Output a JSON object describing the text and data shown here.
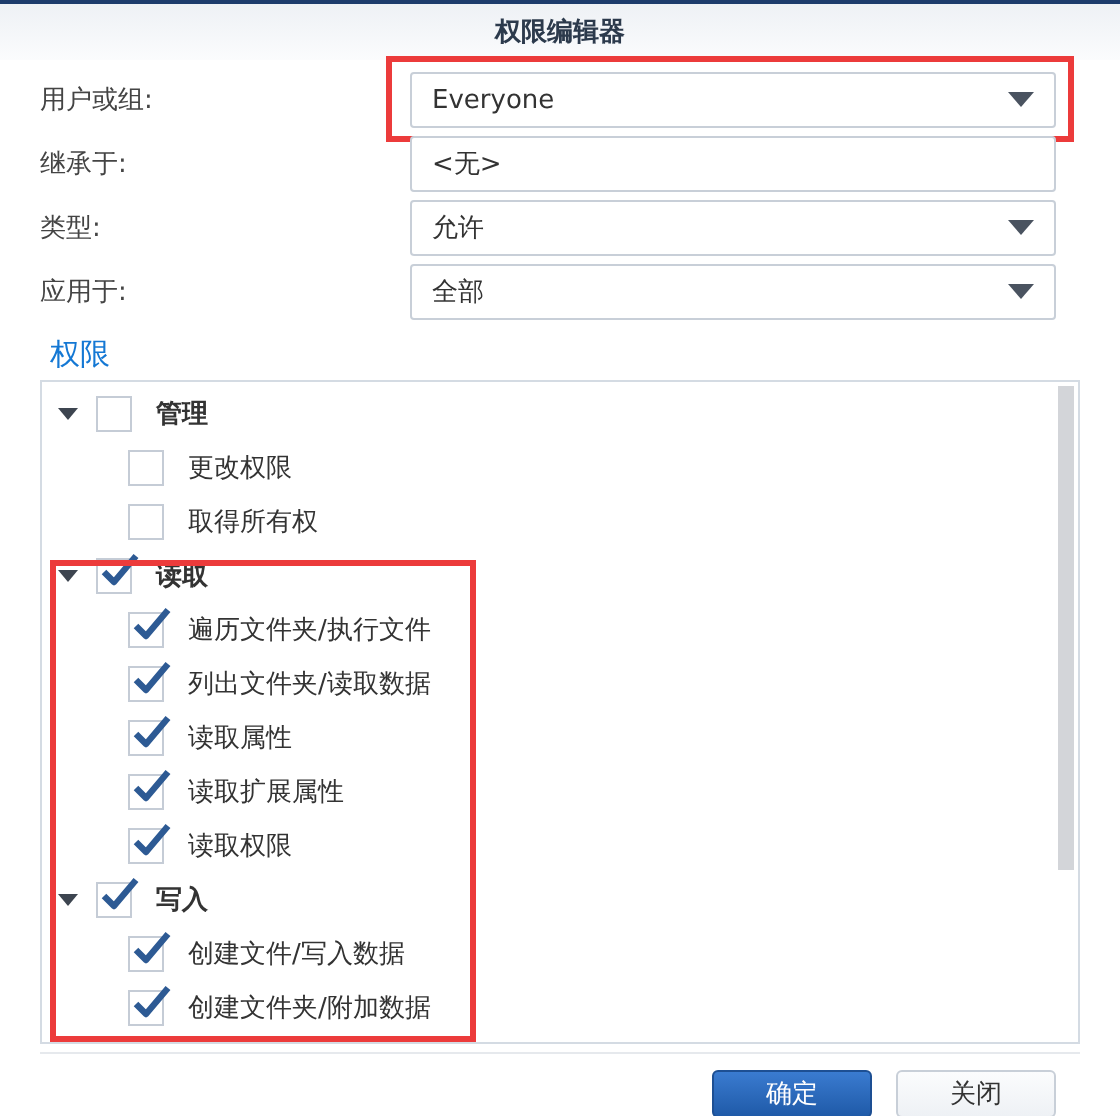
{
  "window": {
    "title": "权限编辑器"
  },
  "fields": [
    {
      "label": "用户或组:",
      "kind": "dropdown",
      "value": "Everyone",
      "highlighted": true
    },
    {
      "label": "继承于:",
      "kind": "text",
      "value": "<无>",
      "highlighted": false
    },
    {
      "label": "类型:",
      "kind": "dropdown",
      "value": "允许",
      "highlighted": false
    },
    {
      "label": "应用于:",
      "kind": "dropdown",
      "value": "全部",
      "highlighted": false
    }
  ],
  "permissions": {
    "title": "权限",
    "groups": [
      {
        "label": "管理",
        "checked": false,
        "expanded": true,
        "highlighted": false,
        "children": [
          {
            "label": "更改权限",
            "checked": false
          },
          {
            "label": "取得所有权",
            "checked": false
          }
        ]
      },
      {
        "label": "读取",
        "checked": true,
        "expanded": true,
        "highlighted": true,
        "children": [
          {
            "label": "遍历文件夹/执行文件",
            "checked": true
          },
          {
            "label": "列出文件夹/读取数据",
            "checked": true
          },
          {
            "label": "读取属性",
            "checked": true
          },
          {
            "label": "读取扩展属性",
            "checked": true
          },
          {
            "label": "读取权限",
            "checked": true
          }
        ]
      },
      {
        "label": "写入",
        "checked": true,
        "expanded": true,
        "highlighted": true,
        "children": [
          {
            "label": "创建文件/写入数据",
            "checked": true
          },
          {
            "label": "创建文件夹/附加数据",
            "checked": true
          }
        ]
      }
    ]
  },
  "buttons": [
    {
      "label": "确定",
      "kind": "primary"
    },
    {
      "label": "关闭",
      "kind": "secondary"
    }
  ]
}
